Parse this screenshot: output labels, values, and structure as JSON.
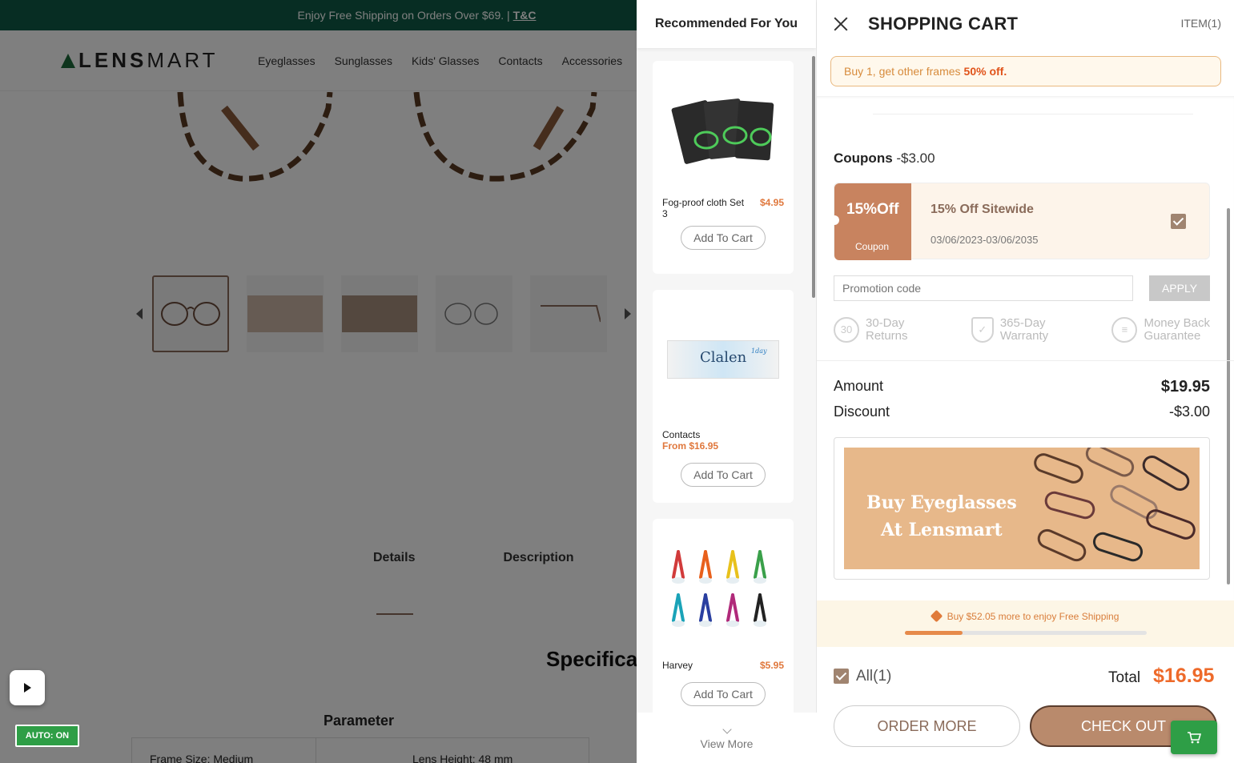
{
  "background_page": {
    "promo_text": "Enjoy Free Shipping on Orders Over $69. |",
    "promo_link": "T&C",
    "logo_bold": "LENS",
    "logo_thin": "MART",
    "nav": [
      "Eyeglasses",
      "Sunglasses",
      "Kids' Glasses",
      "Contacts",
      "Accessories"
    ],
    "tabs": [
      "Details",
      "Description"
    ],
    "specifications_heading": "Specifica",
    "parameter_heading": "Parameter",
    "param_frame_size": "Frame Size: Medium",
    "param_lens_height": "Lens Height: 48 mm",
    "auto_badge": "AUTO: ON"
  },
  "recommended": {
    "title": "Recommended For You",
    "items": [
      {
        "name": "Fog-proof cloth Set 3",
        "price": "$4.95",
        "button": "Add To Cart"
      },
      {
        "name": "Contacts",
        "price": "From $16.95",
        "button": "Add To Cart"
      },
      {
        "name": "Harvey",
        "price": "$5.95",
        "button": "Add To Cart"
      }
    ],
    "view_more": "View More",
    "contacts_brand": "Clalen",
    "contacts_brand_sup": "1day"
  },
  "cart": {
    "title": "SHOPPING CART",
    "item_count": "ITEM(1)",
    "offer_text": "Buy 1, get other frames",
    "offer_highlight": "50% off.",
    "coupons_label": "Coupons",
    "coupons_value": "-$3.00",
    "coupon": {
      "badge": "15%Off",
      "badge_sub": "Coupon",
      "name": "15% Off Sitewide",
      "dates": "03/06/2023-03/06/2035",
      "checked": true
    },
    "promo_placeholder": "Promotion code",
    "apply_label": "APPLY",
    "guarantees": [
      {
        "icon": "30-day-returns-icon",
        "line1": "30-Day",
        "line2": "Returns",
        "badge": "30"
      },
      {
        "icon": "warranty-shield-icon",
        "line1": "365-Day",
        "line2": "Warranty",
        "badge": "✓"
      },
      {
        "icon": "money-back-icon",
        "line1": "Money Back",
        "line2": "Guarantee",
        "badge": "≡"
      }
    ],
    "amount_label": "Amount",
    "amount_value": "$19.95",
    "discount_label": "Discount",
    "discount_value": "-$3.00",
    "banner_line1": "Buy Eyeglasses",
    "banner_line2": "At Lensmart",
    "shipping_text": "Buy $52.05 more to enjoy Free Shipping",
    "shipping_progress": 0.24,
    "all_label": "All(1)",
    "total_label": "Total",
    "total_value": "$16.95",
    "order_more_label": "ORDER MORE",
    "checkout_label": "CHECK OUT"
  },
  "colors": {
    "brand_green": "#0f5b46",
    "accent_orange": "#ee6a2a",
    "brown": "#8a6b5a",
    "coupon_tan": "#c8835f"
  }
}
